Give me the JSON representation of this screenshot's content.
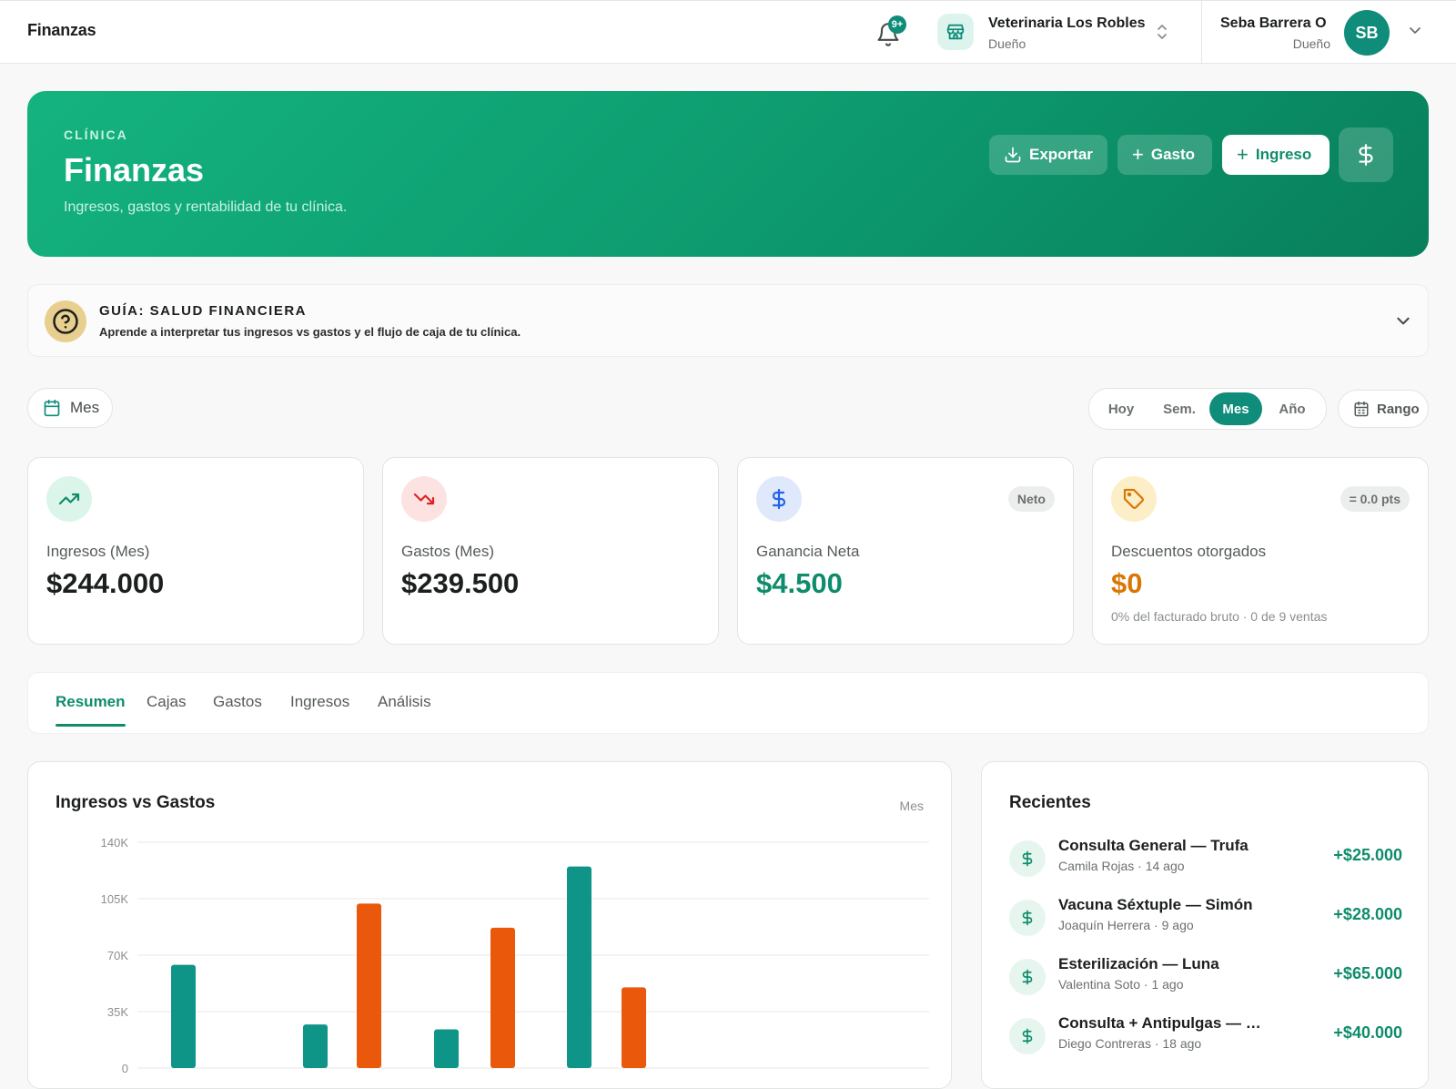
{
  "topbar": {
    "brand": "Finanzas",
    "notifications_badge": "9+",
    "clinic": {
      "name": "Veterinaria Los Robles",
      "role": "Dueño"
    },
    "user": {
      "name": "Seba Barrera O",
      "role": "Dueño",
      "initials": "SB"
    }
  },
  "hero": {
    "kicker": "CLÍNICA",
    "title": "Finanzas",
    "subtitle": "Ingresos, gastos y rentabilidad de tu clínica.",
    "export_label": "Exportar",
    "expense_label": "Gasto",
    "income_label": "Ingreso"
  },
  "guide": {
    "title": "GUÍA: SALUD FINANCIERA",
    "subtitle": "Aprende a interpretar tus ingresos vs gastos y el flujo de caja de tu clínica."
  },
  "filters": {
    "period_label": "Mes",
    "segments": [
      "Hoy",
      "Sem.",
      "Mes",
      "Año"
    ],
    "active_segment": "Mes",
    "range_label": "Rango"
  },
  "kpis": [
    {
      "label": "Ingresos (Mes)",
      "value": "$244.000",
      "icon": "trending-up-icon"
    },
    {
      "label": "Gastos (Mes)",
      "value": "$239.500",
      "icon": "trending-down-icon"
    },
    {
      "label": "Ganancia Neta",
      "value": "$4.500",
      "tag": "Neto",
      "icon": "dollar-icon"
    },
    {
      "label": "Descuentos otorgados",
      "value": "$0",
      "tag": "= 0.0 pts",
      "note": "0% del facturado bruto · 0 de 9 ventas",
      "icon": "tag-icon"
    }
  ],
  "tabs": [
    "Resumen",
    "Cajas",
    "Gastos",
    "Ingresos",
    "Análisis"
  ],
  "chart": {
    "title": "Ingresos vs Gastos",
    "meta": "Mes"
  },
  "chart_data": {
    "type": "bar",
    "title": "Ingresos vs Gastos",
    "ylim": [
      0,
      140000
    ],
    "yticks": [
      "0",
      "35K",
      "70K",
      "105K",
      "140K"
    ],
    "series": [
      {
        "values": [
          64000,
          0,
          27000,
          102000,
          24000,
          87000,
          125000,
          50000,
          0,
          0,
          0,
          0
        ],
        "colors_by_index": true
      }
    ],
    "bars": [
      {
        "kind": "ingreso",
        "value": 64000
      },
      {
        "kind": "ingreso",
        "value": 27000
      },
      {
        "kind": "gasto",
        "value": 102000
      },
      {
        "kind": "ingreso",
        "value": 24000
      },
      {
        "kind": "gasto",
        "value": 87000
      },
      {
        "kind": "ingreso",
        "value": 125000
      },
      {
        "kind": "gasto",
        "value": 50000
      }
    ],
    "colors": {
      "ingreso": "#0f9488",
      "gasto": "#ea580c"
    },
    "grid": true
  },
  "recent": {
    "title": "Recientes",
    "items": [
      {
        "name": "Consulta General — Trufa",
        "sub": "Camila Rojas · 14 ago",
        "amount": "+$25.000"
      },
      {
        "name": "Vacuna Séxtuple — Simón",
        "sub": "Joaquín Herrera · 9 ago",
        "amount": "+$28.000"
      },
      {
        "name": "Esterilización — Luna",
        "sub": "Valentina Soto · 1 ago",
        "amount": "+$65.000"
      },
      {
        "name": "Consulta + Antipulgas — Br...",
        "sub": "Diego Contreras · 18 ago",
        "amount": "+$40.000"
      }
    ]
  }
}
